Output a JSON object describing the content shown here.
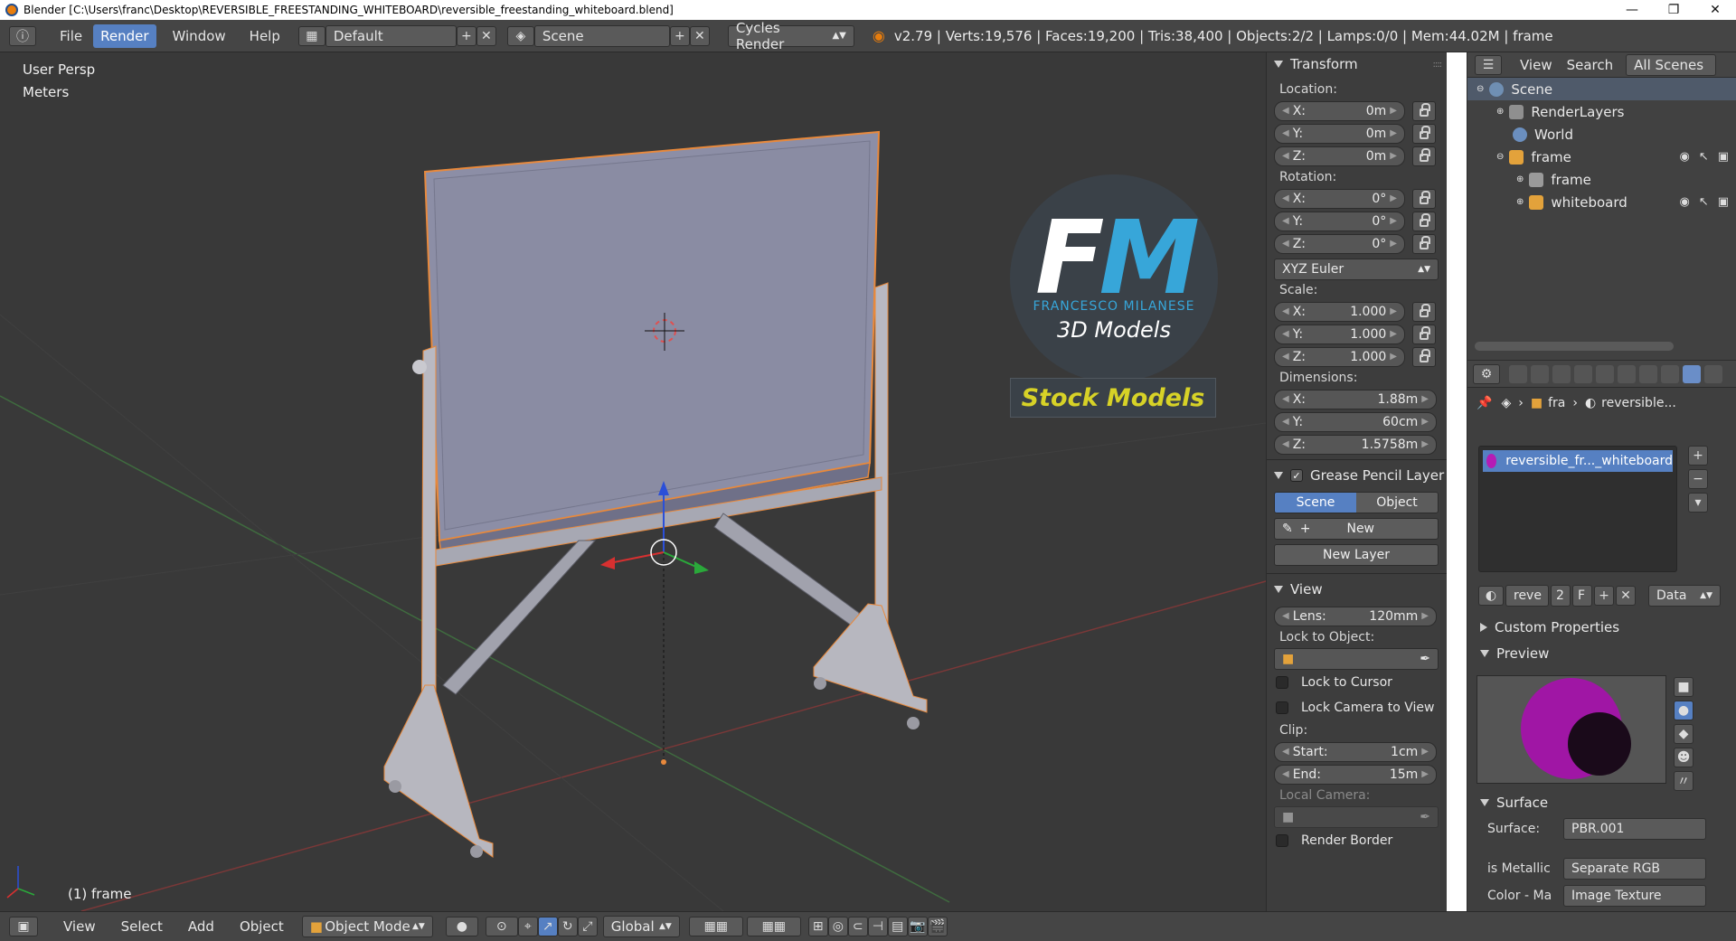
{
  "window": {
    "title": "Blender [C:\\Users\\franc\\Desktop\\REVERSIBLE_FREESTANDING_WHITEBOARD\\reversible_freestanding_whiteboard.blend]",
    "controls": [
      "—",
      "❐",
      "✕"
    ]
  },
  "info_header": {
    "menus": [
      "File",
      "Render",
      "Window",
      "Help"
    ],
    "active_menu": "Render",
    "screen_layout": "Default",
    "scene": "Scene",
    "engine": "Cycles Render",
    "stats": "v2.79 | Verts:19,576 | Faces:19,200 | Tris:38,400 | Objects:2/2 | Lamps:0/0 | Mem:44.02M | frame"
  },
  "viewport": {
    "view_name": "User Persp",
    "units": "Meters",
    "active_object": "(1) frame"
  },
  "overlay": {
    "logo_letters": "FM",
    "logo_name": "FRANCESCO MILANESE",
    "logo_sub": "3D Models",
    "banner": "Stock Models"
  },
  "transform": {
    "title": "Transform",
    "location_label": "Location:",
    "location": [
      {
        "axis": "X:",
        "value": "0m"
      },
      {
        "axis": "Y:",
        "value": "0m"
      },
      {
        "axis": "Z:",
        "value": "0m"
      }
    ],
    "rotation_label": "Rotation:",
    "rotation": [
      {
        "axis": "X:",
        "value": "0°"
      },
      {
        "axis": "Y:",
        "value": "0°"
      },
      {
        "axis": "Z:",
        "value": "0°"
      }
    ],
    "rotation_mode": "XYZ Euler",
    "scale_label": "Scale:",
    "scale": [
      {
        "axis": "X:",
        "value": "1.000"
      },
      {
        "axis": "Y:",
        "value": "1.000"
      },
      {
        "axis": "Z:",
        "value": "1.000"
      }
    ],
    "dimensions_label": "Dimensions:",
    "dimensions": [
      {
        "axis": "X:",
        "value": "1.88m"
      },
      {
        "axis": "Y:",
        "value": "60cm"
      },
      {
        "axis": "Z:",
        "value": "1.5758m"
      }
    ]
  },
  "grease_pencil": {
    "title": "Grease Pencil Layer",
    "tabs": [
      "Scene",
      "Object"
    ],
    "active_tab": "Scene",
    "new_label": "New",
    "new_layer_label": "New Layer"
  },
  "view_panel": {
    "title": "View",
    "lens_label": "Lens:",
    "lens_value": "120mm",
    "lock_object_label": "Lock to Object:",
    "lock_cursor_label": "Lock to Cursor",
    "lock_camera_label": "Lock Camera to View",
    "clip_label": "Clip:",
    "clip_start_label": "Start:",
    "clip_start": "1cm",
    "clip_end_label": "End:",
    "clip_end": "15m",
    "local_camera_label": "Local Camera:",
    "render_border_label": "Render Border"
  },
  "outliner": {
    "menus": [
      "View",
      "Search"
    ],
    "filter": "All Scenes",
    "items": [
      {
        "label": "Scene",
        "indent": 0
      },
      {
        "label": "RenderLayers",
        "indent": 1
      },
      {
        "label": "World",
        "indent": 1
      },
      {
        "label": "frame",
        "indent": 1
      },
      {
        "label": "frame",
        "indent": 2
      },
      {
        "label": "whiteboard",
        "indent": 2
      }
    ]
  },
  "properties": {
    "breadcrumb_object": "fra",
    "breadcrumb_material": "reversible...",
    "material_slot": "reversible_fr..._whiteboard",
    "material_name": "reve",
    "user_count": "2",
    "fake_user": "F",
    "link_mode": "Data",
    "custom_props_label": "Custom Properties",
    "preview_label": "Preview",
    "surface_label": "Surface",
    "surface_field_label": "Surface:",
    "surface_value": "PBR.001",
    "metallic_label": "is Metallic",
    "metallic_value": "Separate RGB",
    "color_label": "Color - Ma",
    "color_value": "Image Texture"
  },
  "bottom_header": {
    "menus": [
      "View",
      "Select",
      "Add",
      "Object"
    ],
    "mode": "Object Mode",
    "orientation": "Global"
  },
  "colors": {
    "accent": "#5680c2",
    "header": "#454545",
    "viewport_bg": "#393939",
    "selection_outline": "#e8893c",
    "board": "#8c8ea6",
    "frame": "#b9b9c2"
  }
}
